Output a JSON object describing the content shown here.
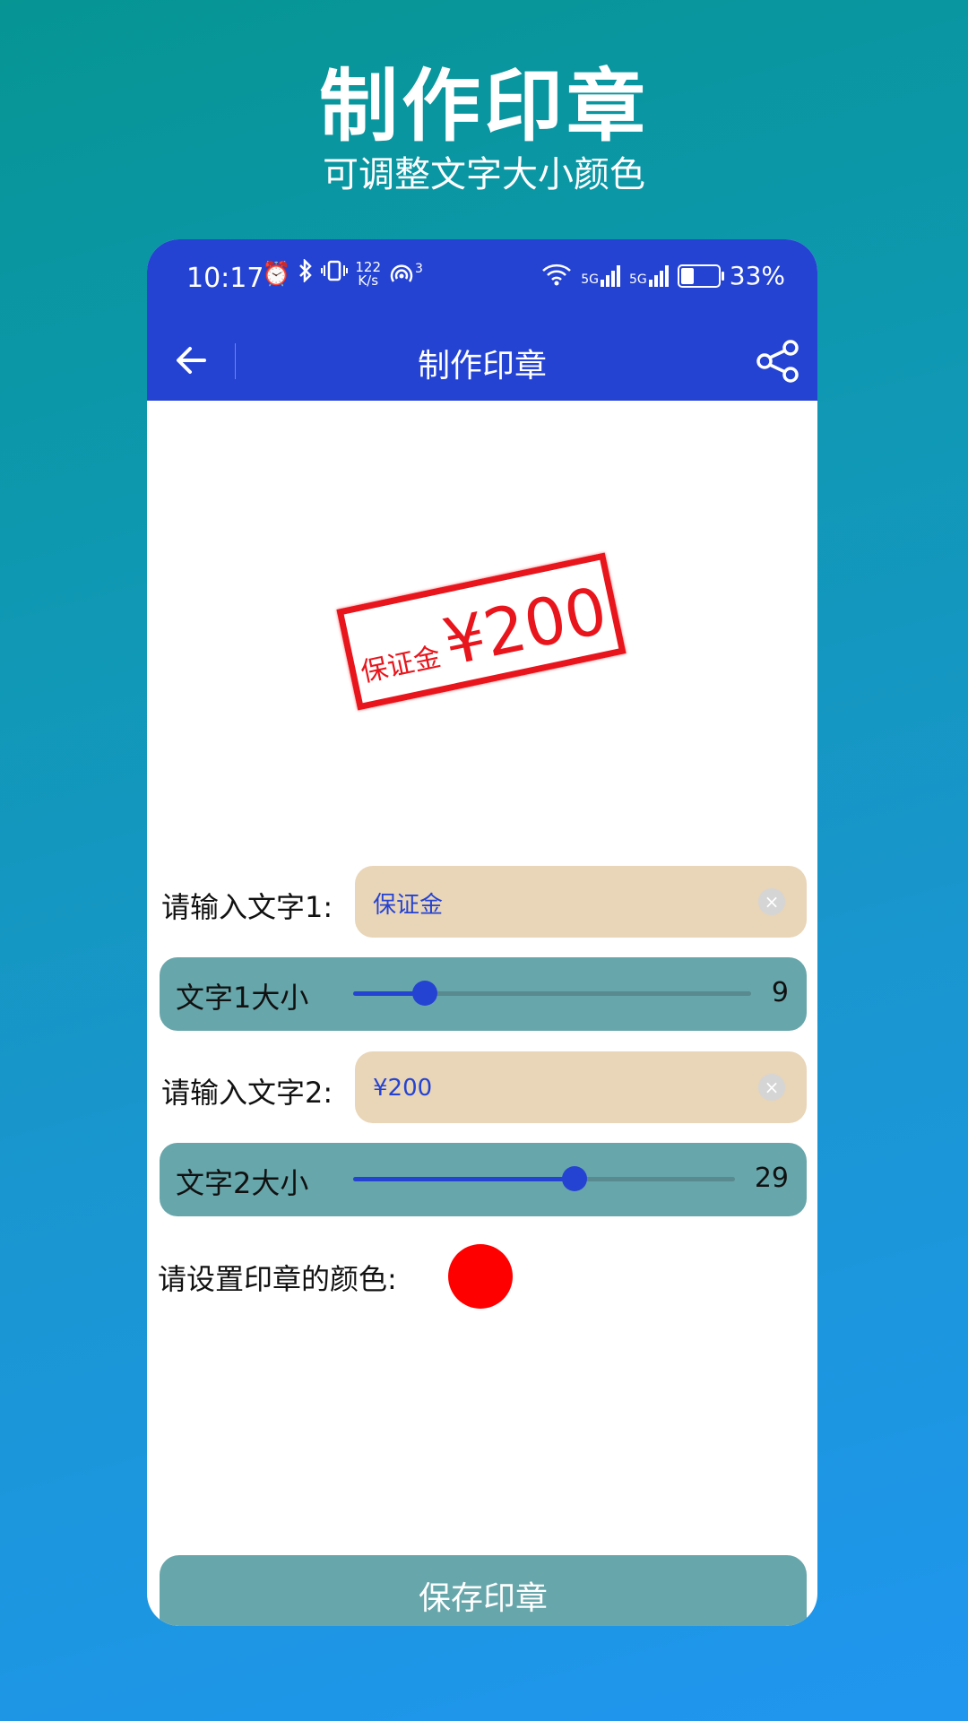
{
  "promo": {
    "title": "制作印章",
    "subtitle": "可调整文字大小颜色"
  },
  "status_bar": {
    "time": "10:17",
    "netspeed_value": "122",
    "netspeed_unit": "K/s",
    "hotspot_count": "3",
    "sim1_label": "5G",
    "sim2_label": "5G",
    "battery": "33%"
  },
  "app_bar": {
    "title": "制作印章",
    "back_icon": "arrow-left-icon",
    "share_icon": "share-icon"
  },
  "stamp": {
    "text1": "保证金",
    "text2": "¥200",
    "color": "#e8151c"
  },
  "form": {
    "text1_label": "请输入文字1:",
    "text1_value": "保证金",
    "text1_size_label": "文字1大小",
    "text1_size_value": "9",
    "text1_size_fraction": 0.18,
    "text2_label": "请输入文字2:",
    "text2_value": "¥200",
    "text2_size_label": "文字2大小",
    "text2_size_value": "29",
    "text2_size_fraction": 0.58,
    "color_label": "请设置印章的颜色:",
    "stamp_color": "#ff0000"
  },
  "save_button": "保存印章",
  "colors": {
    "primary": "#2543d2",
    "input_bg": "#e9d5b7",
    "slider_bg": "#67a6ab"
  }
}
